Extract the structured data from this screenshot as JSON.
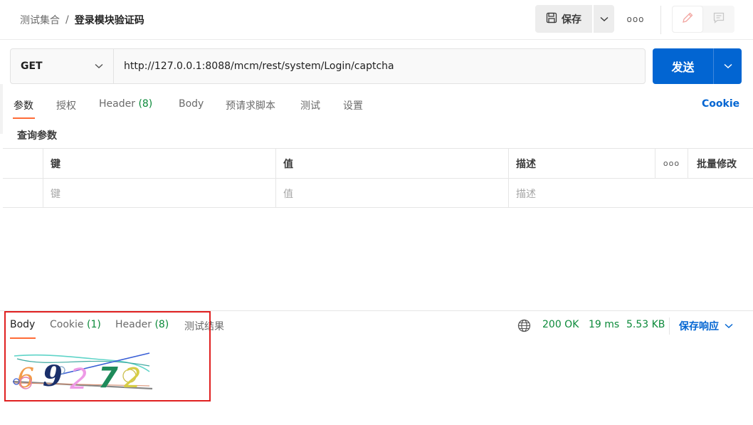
{
  "breadcrumb": {
    "parent": "测试集合",
    "separator": "/",
    "current": "登录模块验证码"
  },
  "toolbar": {
    "save_label": "保存",
    "more_label": "ooo"
  },
  "request": {
    "method": "GET",
    "url": "http://127.0.0.1:8088/mcm/rest/system/Login/captcha",
    "send_label": "发送"
  },
  "req_tabs": [
    {
      "label": "参数"
    },
    {
      "label": "授权"
    },
    {
      "label": "Header",
      "count": "(8)"
    },
    {
      "label": "Body"
    },
    {
      "label": "预请求脚本"
    },
    {
      "label": "测试"
    },
    {
      "label": "设置"
    }
  ],
  "cookie_link": "Cookie",
  "params": {
    "section_title": "查询参数",
    "headers": {
      "key": "键",
      "value": "值",
      "description": "描述",
      "more": "ooo",
      "bulk_edit": "批量修改"
    },
    "placeholder_row": {
      "key": "键",
      "value": "值",
      "description": "描述"
    }
  },
  "response": {
    "tabs": [
      {
        "label": "Body"
      },
      {
        "label": "Cookie",
        "count": "(1)"
      },
      {
        "label": "Header",
        "count": "(8)"
      },
      {
        "label": "测试结果"
      }
    ],
    "status": "200 OK",
    "time": "19 ms",
    "size": "5.53 KB",
    "save_label": "保存响应",
    "captcha_text": "69272"
  },
  "colors": {
    "accent": "#ff6c37",
    "primary": "#0265d2",
    "success": "#0c8a3a",
    "highlight_box": "#e02020"
  },
  "icons": {
    "save": "floppy-disk-icon",
    "caret": "chevron-down-icon",
    "edit": "pencil-icon",
    "comment": "comment-icon",
    "globe": "globe-icon"
  }
}
